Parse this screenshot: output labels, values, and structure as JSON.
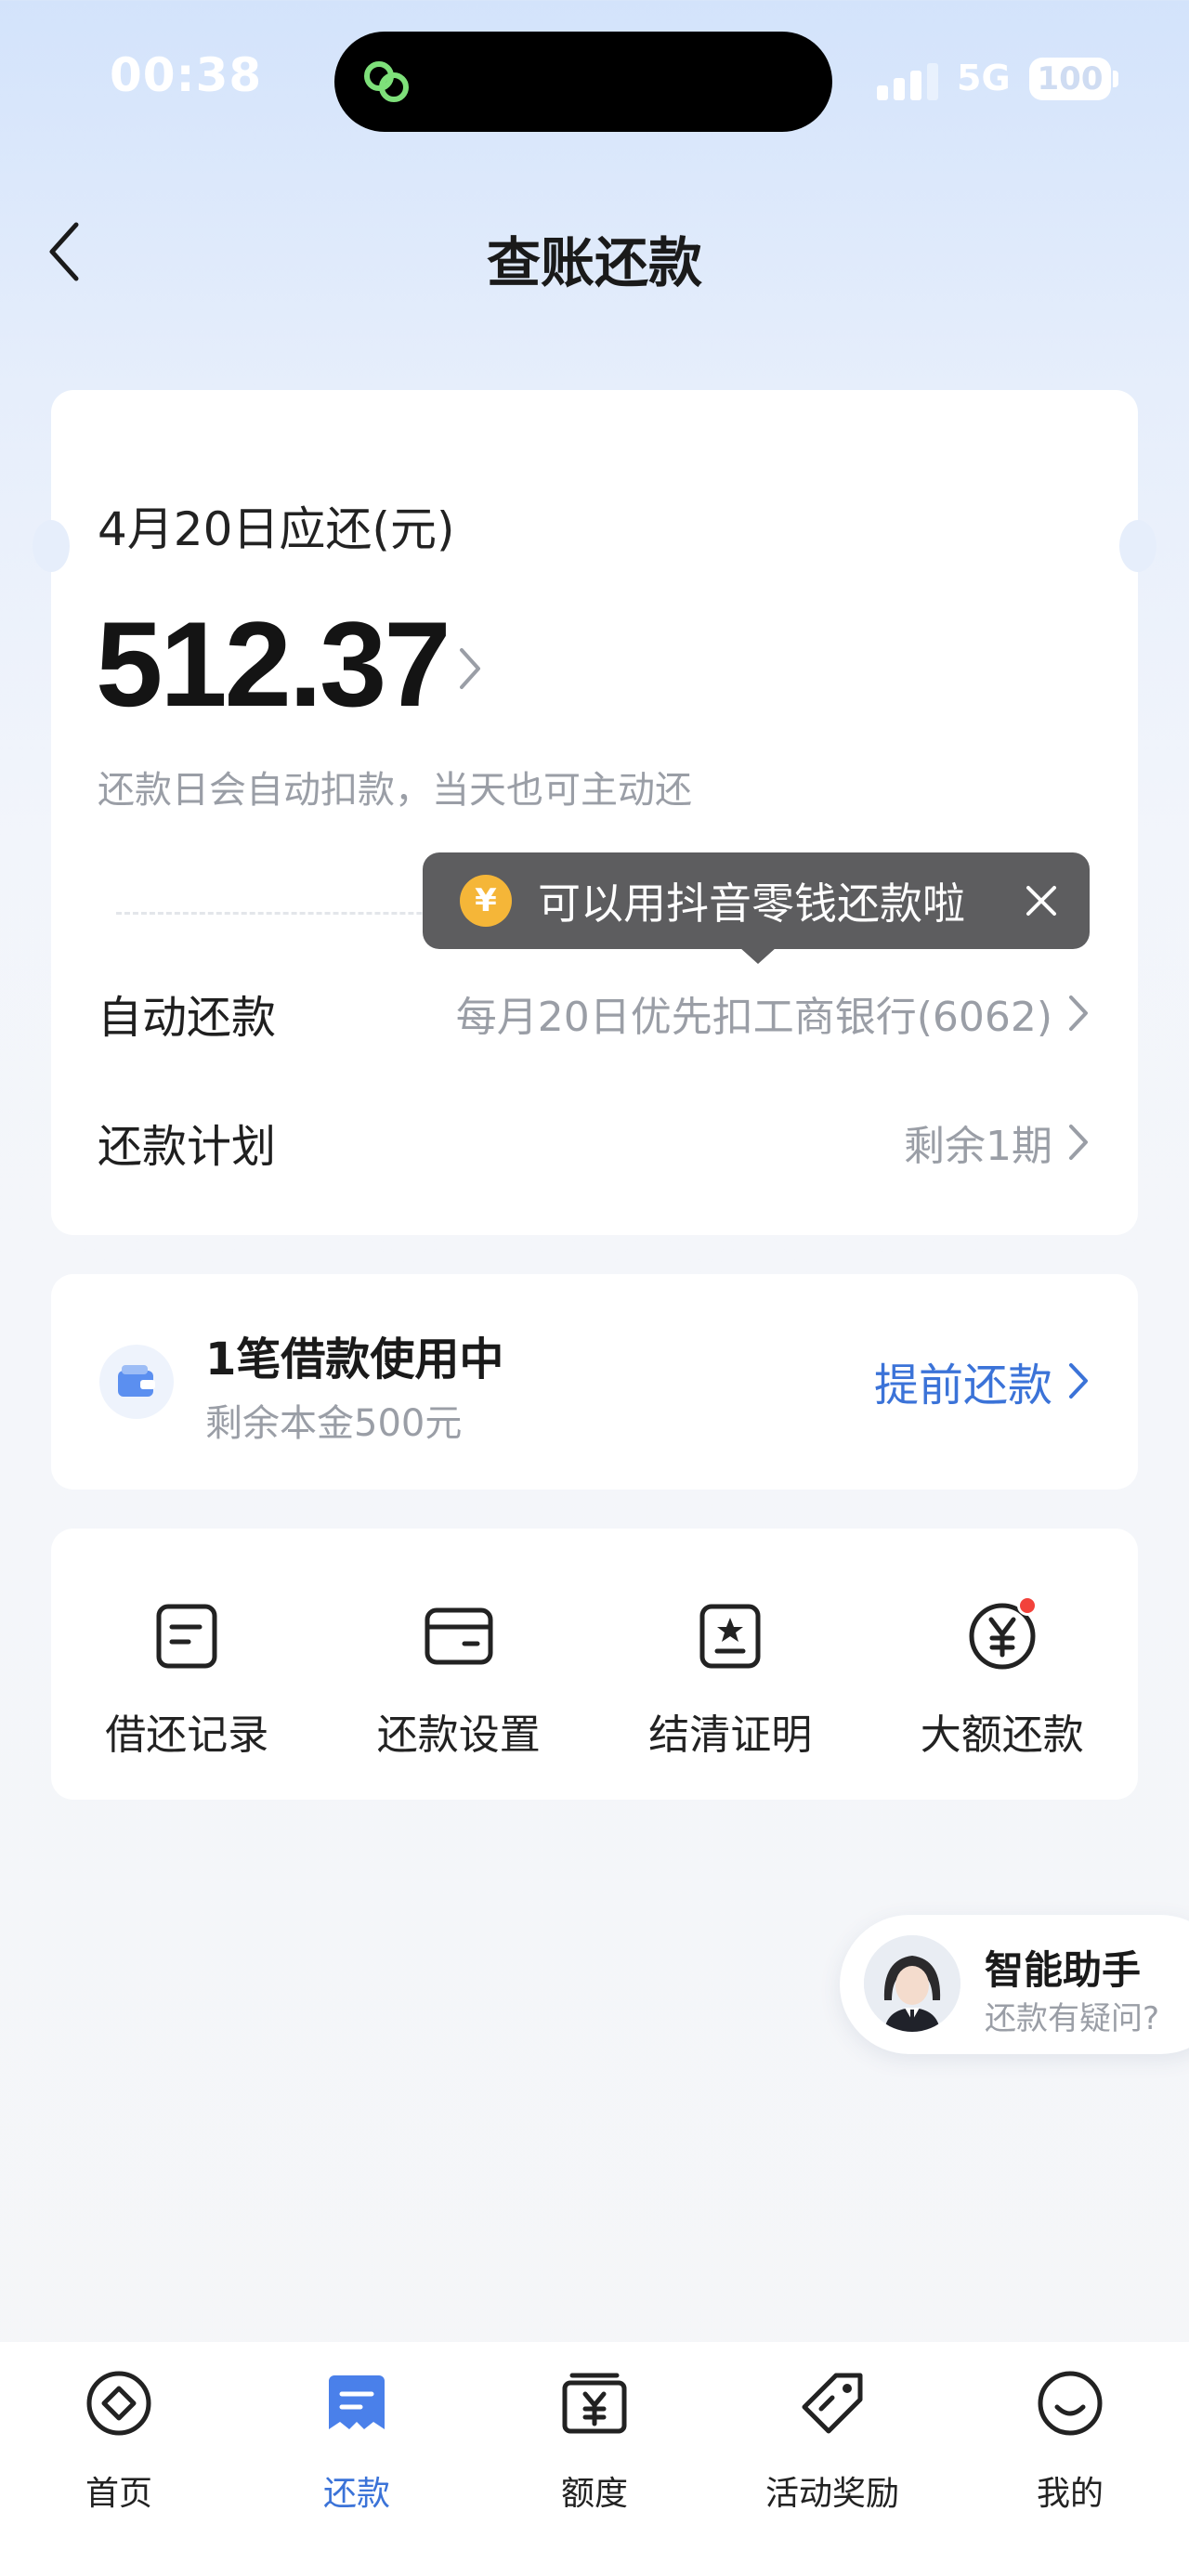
{
  "status_bar": {
    "time": "00:38",
    "network": "5G",
    "battery": "100"
  },
  "header": {
    "title": "查账还款"
  },
  "bill": {
    "due_label": "4月20日应还(元)",
    "amount": "512.37",
    "hint": "还款日会自动扣款，当天也可主动还",
    "auto_repay_label": "自动还款",
    "auto_repay_value": "每月20日优先扣工商银行(6062)",
    "plan_label": "还款计划",
    "plan_value": "剩余1期"
  },
  "tooltip": {
    "coin_symbol": "¥",
    "text": "可以用抖音零钱还款啦"
  },
  "loan": {
    "title": "1笔借款使用中",
    "subtitle": "剩余本金500元",
    "action": "提前还款"
  },
  "shortcuts": [
    {
      "label": "借还记录",
      "icon": "record-icon"
    },
    {
      "label": "还款设置",
      "icon": "card-settings-icon"
    },
    {
      "label": "结清证明",
      "icon": "certificate-icon"
    },
    {
      "label": "大额还款",
      "icon": "yen-circle-icon",
      "badge": true
    }
  ],
  "assistant": {
    "title": "智能助手",
    "subtitle": "还款有疑问?"
  },
  "nav": [
    {
      "label": "首页",
      "icon": "home-icon",
      "active": false
    },
    {
      "label": "还款",
      "icon": "repay-icon",
      "active": true
    },
    {
      "label": "额度",
      "icon": "quota-icon",
      "active": false
    },
    {
      "label": "活动奖励",
      "icon": "tag-icon",
      "active": false
    },
    {
      "label": "我的",
      "icon": "profile-icon",
      "active": false
    }
  ],
  "colors": {
    "accent": "#3b73d8",
    "tooltip_bg": "#5d5d5f",
    "coin": "#f5b638",
    "badge": "#f2423b",
    "secondary_text": "#9a9ea6"
  }
}
